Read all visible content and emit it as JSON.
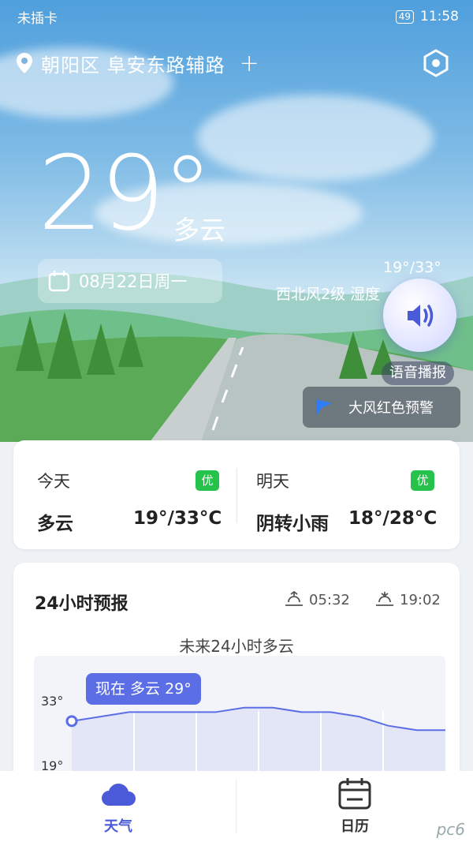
{
  "status_bar": {
    "carrier": "未插卡",
    "battery": "49",
    "time": "11:58"
  },
  "location": {
    "name": "朝阳区 阜安东路辅路",
    "add": "+"
  },
  "current": {
    "temp": "29°",
    "condition": "多云",
    "date": "08月22日周一",
    "range": "19°/33°",
    "wind": "西北风2级 湿度"
  },
  "voice": {
    "label": "语音播报"
  },
  "alert": {
    "text": "大风红色预警",
    "color": "#2f7cf6"
  },
  "today": {
    "title": "今天",
    "aq": "优",
    "weather": "多云",
    "temp": "19°/33°C"
  },
  "tomorrow": {
    "title": "明天",
    "aq": "优",
    "weather": "阴转小雨",
    "temp": "18°/28°C"
  },
  "forecast": {
    "title": "24小时预报",
    "sunrise": "05:32",
    "sunset": "19:02",
    "summary": "未来24小时多云",
    "tooltip": "现在 多云 29°",
    "y_max": "33°",
    "y_min": "19°",
    "series": [
      29,
      30,
      31,
      31,
      31,
      31,
      32,
      32,
      31,
      31,
      30,
      28,
      27,
      27
    ],
    "line_color": "#5c6ee6"
  },
  "tabs": [
    {
      "label": "天气",
      "active": true
    },
    {
      "label": "日历",
      "active": false
    }
  ],
  "watermark": "pc6"
}
